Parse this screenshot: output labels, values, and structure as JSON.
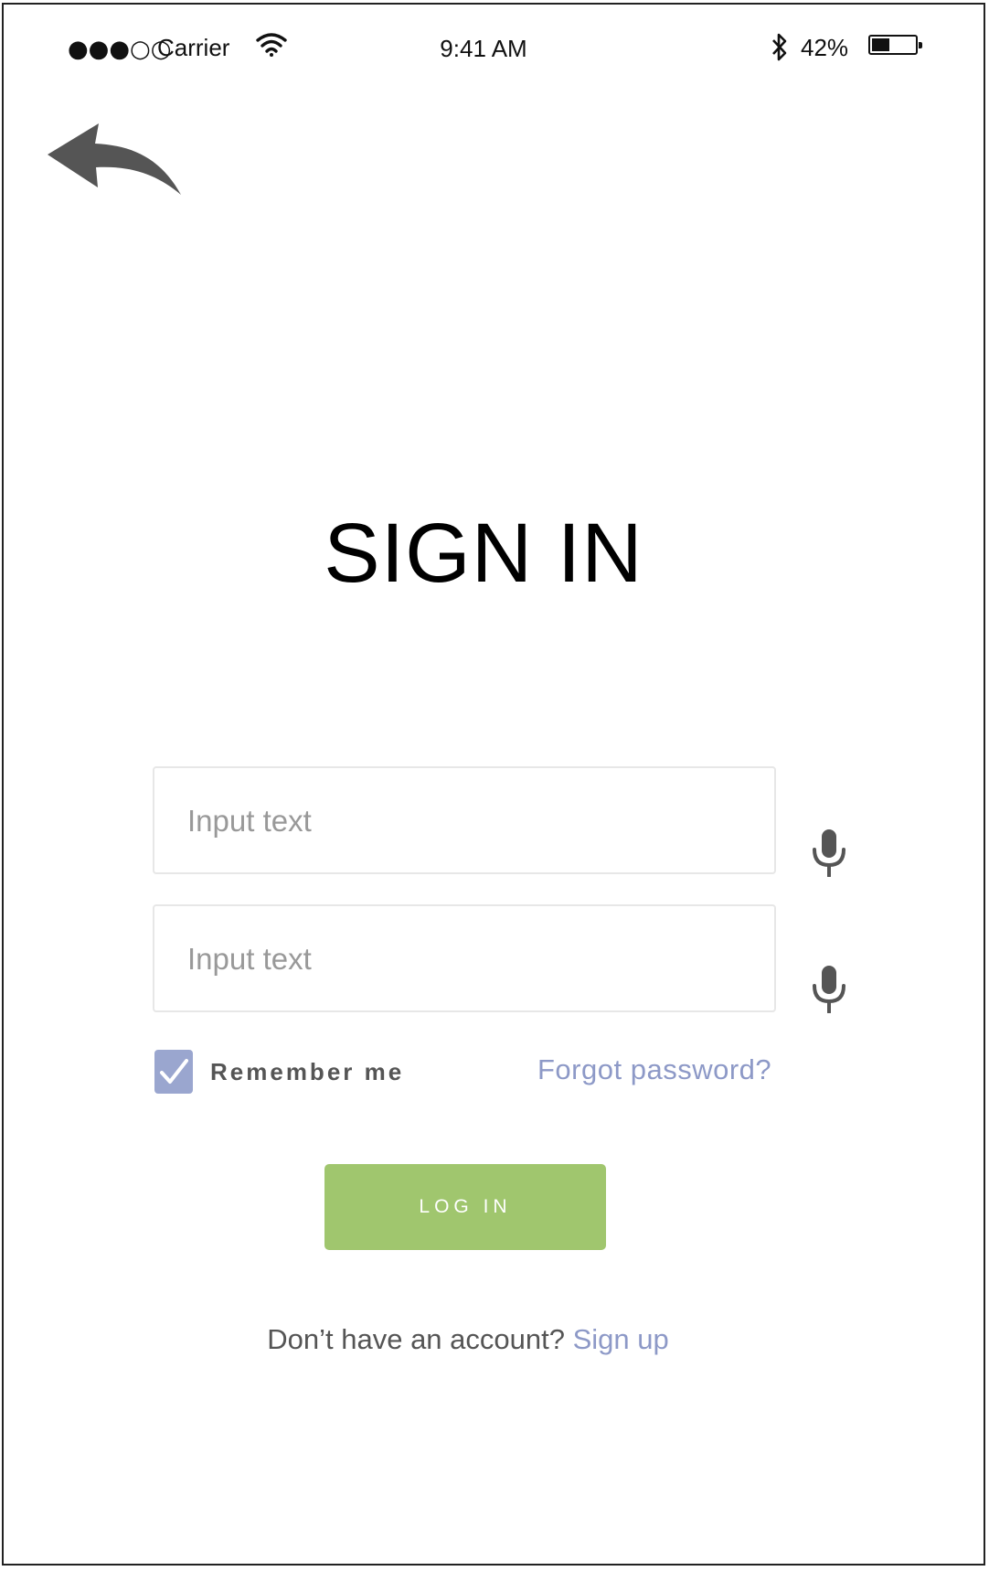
{
  "status_bar": {
    "signal_dots": "●●●○○",
    "carrier": "Carrier",
    "time": "9:41 AM",
    "battery_percent": "42%",
    "battery_level": 0.42
  },
  "header": {
    "back_icon": "curved-back-arrow-icon"
  },
  "main": {
    "title": "SIGN IN",
    "inputs": [
      {
        "placeholder": "Input text",
        "value": ""
      },
      {
        "placeholder": "Input text",
        "value": ""
      }
    ],
    "mic_icon": "microphone-icon",
    "remember_label": "Remember me",
    "remember_checked": true,
    "forgot_label": "Forgot password?",
    "login_label": "LOG IN",
    "signup_prompt": "Don’t have an account?",
    "signup_link": "Sign up"
  },
  "colors": {
    "accent_link": "#8d99c7",
    "checkbox": "#9aa6cf",
    "login_button": "#a0c66e",
    "icon_gray": "#555555"
  }
}
